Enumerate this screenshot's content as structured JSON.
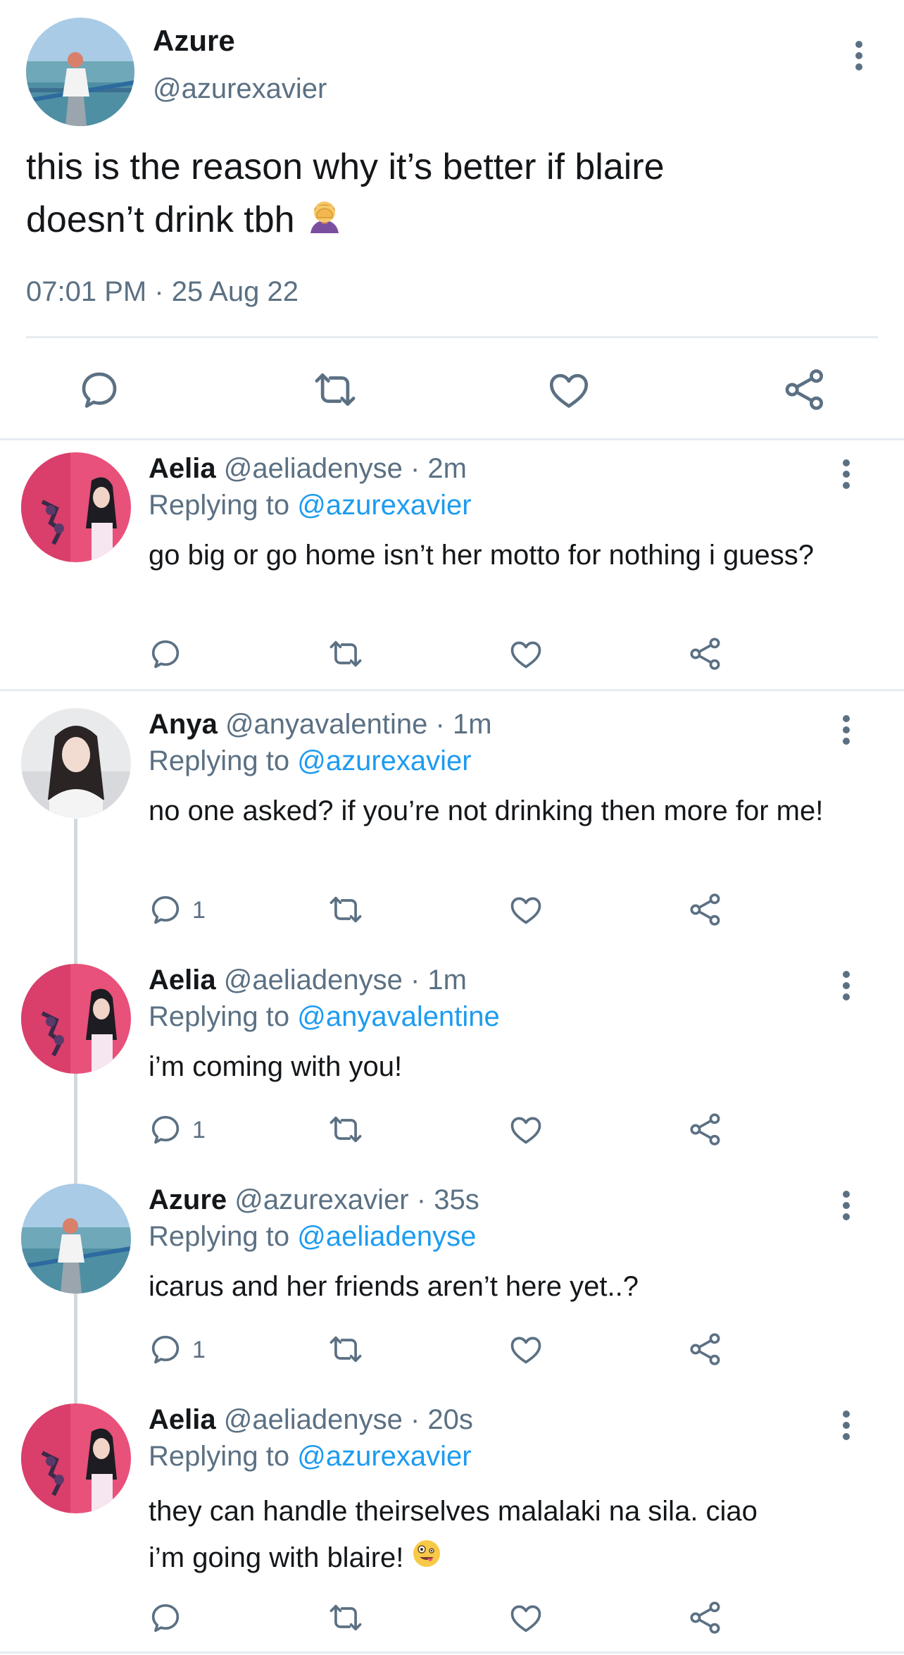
{
  "main_tweet": {
    "name": "Azure",
    "handle": "@azurexavier",
    "text_line1": "this is the reason why it’s better if blaire",
    "text_line2": "doesn’t drink tbh",
    "time": "07:01 PM · 25 Aug 22",
    "emoji_icon": "face-palm-emoji"
  },
  "replies": [
    {
      "name": "Aelia",
      "handle": "@aeliadenyse",
      "age": "· 2m",
      "replying_label": "Replying to",
      "replying_to": "@azurexavier",
      "text": "go big or go home isn’t her motto for nothing i guess?",
      "reply_count": ""
    },
    {
      "name": "Anya",
      "handle": "@anyavalentine",
      "age": "· 1m",
      "replying_label": "Replying to",
      "replying_to": "@azurexavier",
      "text": "no one asked? if you’re not drinking then more for me!",
      "reply_count": "1"
    },
    {
      "name": "Aelia",
      "handle": "@aeliadenyse",
      "age": "· 1m",
      "replying_label": "Replying to",
      "replying_to": "@anyavalentine",
      "text": "i’m coming with you!",
      "reply_count": "1"
    },
    {
      "name": "Azure",
      "handle": "@azurexavier",
      "age": "· 35s",
      "replying_label": "Replying to",
      "replying_to": "@aeliadenyse",
      "text": "icarus and her friends aren’t here yet..?",
      "reply_count": "1"
    },
    {
      "name": "Aelia",
      "handle": "@aeliadenyse",
      "age": "· 20s",
      "replying_label": "Replying to",
      "replying_to": "@azurexavier",
      "text_line1": "they can handle theirselves malalaki na sila. ciao",
      "text_line2": "i’m going with blaire!",
      "reply_count": "",
      "emoji_icon": "zany-face-emoji"
    }
  ],
  "colors": {
    "text": "#14171a",
    "secondary": "#5b7083",
    "link": "#1d9bf0",
    "divider": "#e6ecf0",
    "thread_line": "#cfd9de"
  }
}
